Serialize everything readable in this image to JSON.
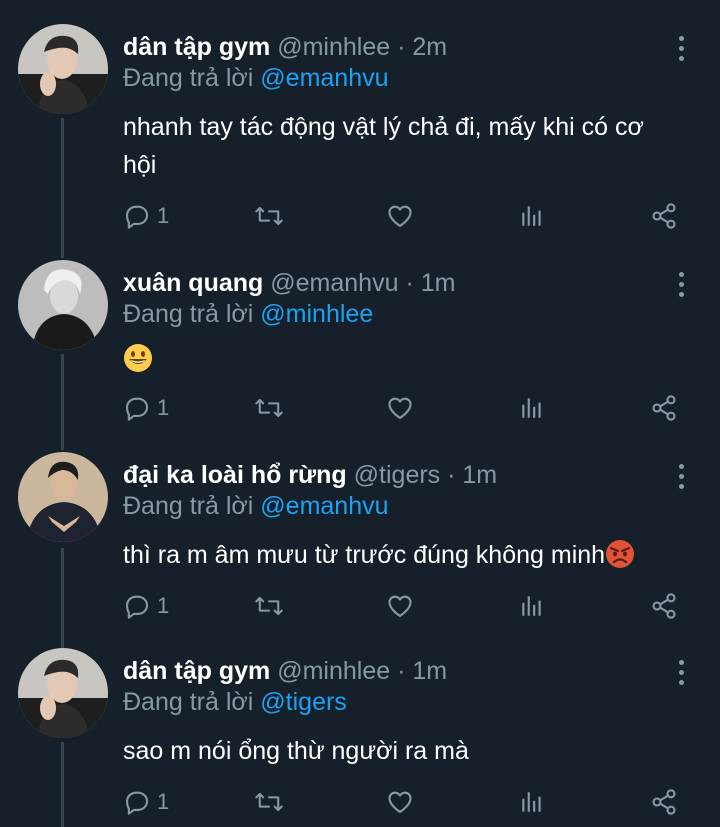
{
  "tweets": [
    {
      "name": "dân tập gym",
      "handle": "@minhlee",
      "sep": "·",
      "time": "2m",
      "reply_prefix": "Đang trả lời",
      "reply_to": "@emanhvu",
      "text": "nhanh tay tác động vật lý chả đi, mấy khi có cơ hội",
      "reply_count": "1",
      "avatar": "person-avatar-1"
    },
    {
      "name": "xuân quang",
      "handle": "@emanhvu",
      "sep": "·",
      "time": "1m",
      "reply_prefix": "Đang trả lời",
      "reply_to": "@minhlee",
      "text": "",
      "emoji": "grinning-face-emoji",
      "reply_count": "1",
      "avatar": "person-avatar-2"
    },
    {
      "name": "đại ka loài hổ rừng",
      "handle": "@tigers",
      "sep": "·",
      "time": "1m",
      "reply_prefix": "Đang trả lời",
      "reply_to": "@emanhvu",
      "text": "thì ra m âm mưu từ trước đúng không minh",
      "emoji": "angry-face-emoji",
      "reply_count": "1",
      "avatar": "person-avatar-3"
    },
    {
      "name": "dân tập gym",
      "handle": "@minhlee",
      "sep": "·",
      "time": "1m",
      "reply_prefix": "Đang trả lời",
      "reply_to": "@tigers",
      "text": "sao m nói ổng thừ người ra mà",
      "reply_count": "1",
      "avatar": "person-avatar-1"
    }
  ],
  "colors": {
    "background": "#15202b",
    "muted": "#8899a6",
    "accent": "#1da1f2",
    "thread_line": "#38444d"
  },
  "icons": {
    "reply": "reply-icon",
    "retweet": "retweet-icon",
    "like": "heart-icon",
    "analytics": "analytics-icon",
    "share": "share-icon",
    "more": "more-vertical-icon"
  }
}
